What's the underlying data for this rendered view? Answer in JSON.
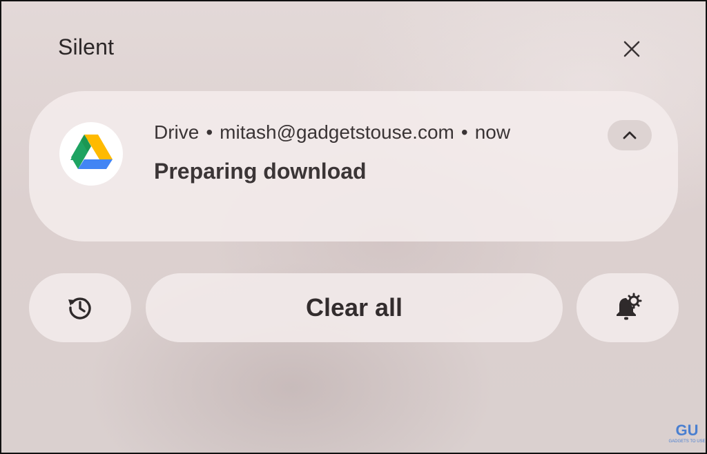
{
  "header": {
    "title": "Silent"
  },
  "notification": {
    "app_name": "Drive",
    "separator": "•",
    "account": "mitash@gadgetstouse.com",
    "time": "now",
    "title": "Preparing download",
    "icon": "google-drive-icon"
  },
  "actions": {
    "history_icon": "history-icon",
    "clear_all_label": "Clear all",
    "settings_icon": "notification-settings-icon"
  },
  "watermark": {
    "logo": "GU",
    "text": "GADGETS TO USE"
  },
  "colors": {
    "drive_green": "#1ea362",
    "drive_yellow": "#ffba00",
    "drive_blue": "#4285f4"
  }
}
